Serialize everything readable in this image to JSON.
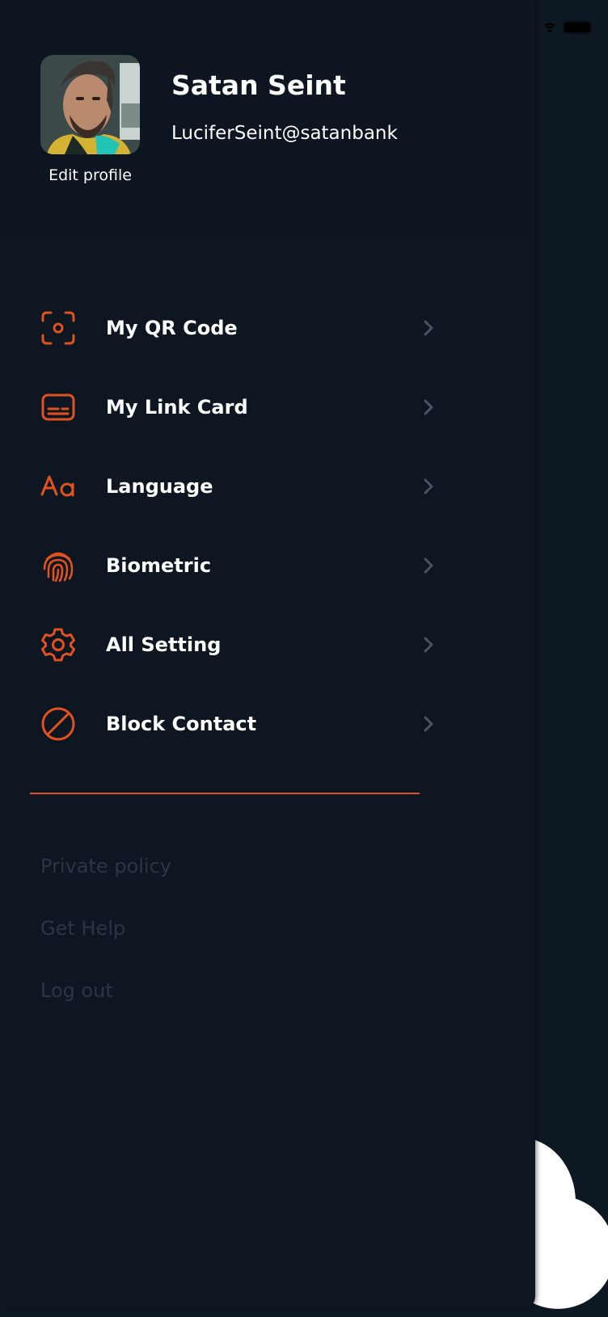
{
  "profile": {
    "name": "Satan Seint",
    "email": "LuciferSeint@satanbank",
    "edit_label": "Edit profile",
    "avatar_icon": "user-avatar-photo"
  },
  "menu": {
    "items": [
      {
        "label": "My QR Code",
        "icon": "qr-scan-icon"
      },
      {
        "label": "My Link Card",
        "icon": "card-icon"
      },
      {
        "label": "Language",
        "icon": "font-icon"
      },
      {
        "label": "Biometric",
        "icon": "fingerprint-icon"
      },
      {
        "label": "All Setting",
        "icon": "gear-icon"
      },
      {
        "label": "Block Contact",
        "icon": "block-icon"
      }
    ]
  },
  "footer": {
    "privacy": "Private policy",
    "help": "Get Help",
    "logout": "Log out"
  },
  "colors": {
    "accent": "#e0521f",
    "background": "#0d1621",
    "text": "#ffffff",
    "muted": "#2c3642",
    "chevron": "#4a5561"
  }
}
